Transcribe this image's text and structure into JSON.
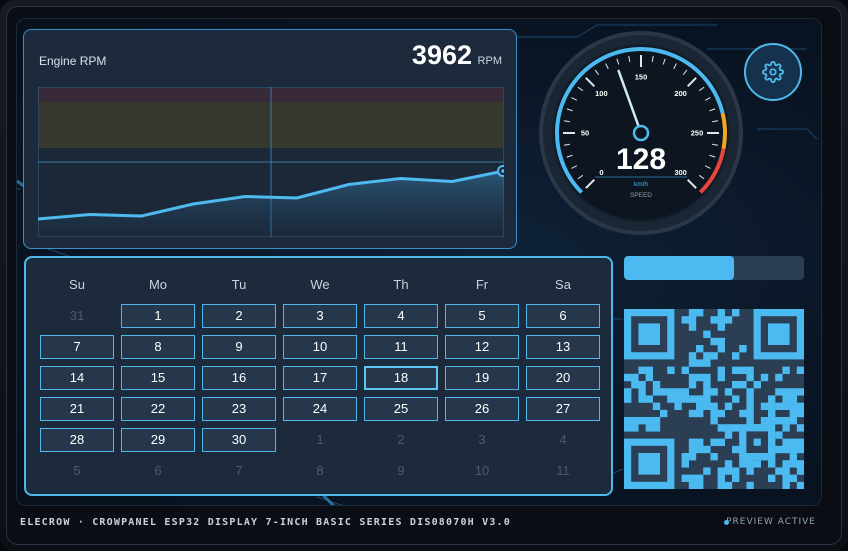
{
  "rpm": {
    "title": "Engine RPM",
    "value": "3962",
    "unit": "RPM",
    "series": [
      12,
      15,
      14,
      22,
      27,
      26,
      35,
      39,
      37,
      44
    ]
  },
  "gauge": {
    "value": "128",
    "unit": "km/h",
    "label": "SPEED",
    "ticks": [
      "0",
      "50",
      "100",
      "150",
      "200",
      "250",
      "300"
    ],
    "needle_value": 128,
    "max": 300,
    "accent": "#4bbaf0",
    "warn": "#f5a623",
    "danger": "#e8433c"
  },
  "settings": {
    "icon": "gear-icon"
  },
  "progress": {
    "fraction": 0.61,
    "color": "#4bbaf0"
  },
  "calendar": {
    "weekdays": [
      "Su",
      "Mo",
      "Tu",
      "We",
      "Th",
      "Fr",
      "Sa"
    ],
    "weeks": [
      [
        {
          "d": "31",
          "o": true
        },
        {
          "d": "1"
        },
        {
          "d": "2"
        },
        {
          "d": "3"
        },
        {
          "d": "4"
        },
        {
          "d": "5"
        },
        {
          "d": "6"
        }
      ],
      [
        {
          "d": "7"
        },
        {
          "d": "8"
        },
        {
          "d": "9"
        },
        {
          "d": "10"
        },
        {
          "d": "11"
        },
        {
          "d": "12"
        },
        {
          "d": "13"
        }
      ],
      [
        {
          "d": "14"
        },
        {
          "d": "15"
        },
        {
          "d": "16"
        },
        {
          "d": "17"
        },
        {
          "d": "18",
          "t": true
        },
        {
          "d": "19"
        },
        {
          "d": "20"
        }
      ],
      [
        {
          "d": "21"
        },
        {
          "d": "22"
        },
        {
          "d": "23"
        },
        {
          "d": "24"
        },
        {
          "d": "25"
        },
        {
          "d": "26"
        },
        {
          "d": "27"
        }
      ],
      [
        {
          "d": "28"
        },
        {
          "d": "29"
        },
        {
          "d": "30"
        },
        {
          "d": "1",
          "o": true
        },
        {
          "d": "2",
          "o": true
        },
        {
          "d": "3",
          "o": true
        },
        {
          "d": "4",
          "o": true
        }
      ],
      [
        {
          "d": "5",
          "o": true
        },
        {
          "d": "6",
          "o": true
        },
        {
          "d": "7",
          "o": true
        },
        {
          "d": "8",
          "o": true
        },
        {
          "d": "9",
          "o": true
        },
        {
          "d": "10",
          "o": true
        },
        {
          "d": "11",
          "o": true
        }
      ]
    ],
    "today": "18"
  },
  "footer": {
    "device": "ELECROW · CROWPANEL ESP32 DISPLAY 7-INCH BASIC SERIES DIS08070H V3.0",
    "status": "PREVIEW ACTIVE"
  }
}
